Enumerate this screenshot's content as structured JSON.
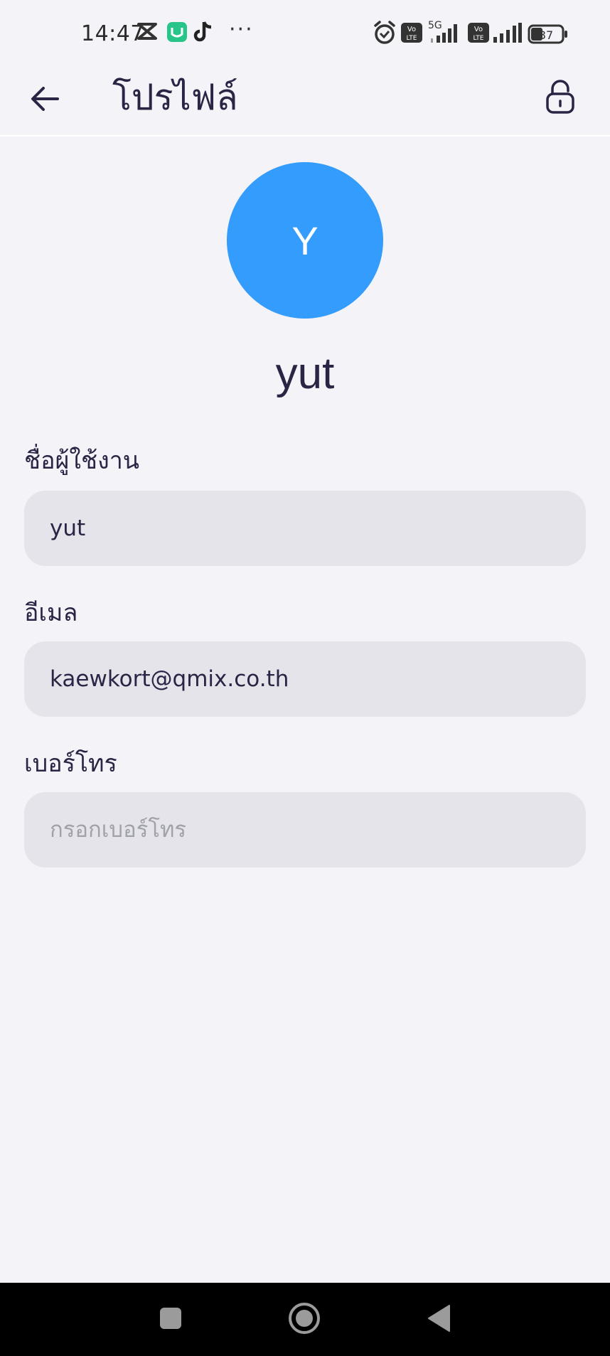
{
  "status_bar": {
    "time": "14:47",
    "more": "···",
    "network_label": "5G",
    "volte_label": "Vo LTE",
    "battery": "37"
  },
  "app_bar": {
    "title": "โปรไฟล์",
    "back_icon": "arrow-left-icon",
    "lock_icon": "lock-icon"
  },
  "profile": {
    "avatar_initial": "Y",
    "avatar_color": "#339cfc",
    "display_name": "yut"
  },
  "form": {
    "username": {
      "label": "ชื่อผู้ใช้งาน",
      "value": "yut"
    },
    "email": {
      "label": "อีเมล",
      "value": "kaewkort@qmix.co.th"
    },
    "phone": {
      "label": "เบอร์โทร",
      "value": "",
      "placeholder": "กรอกเบอร์โทร"
    }
  },
  "nav_bar": {
    "recents_icon": "square-icon",
    "home_icon": "circle-home-icon",
    "back_icon": "triangle-back-icon"
  }
}
